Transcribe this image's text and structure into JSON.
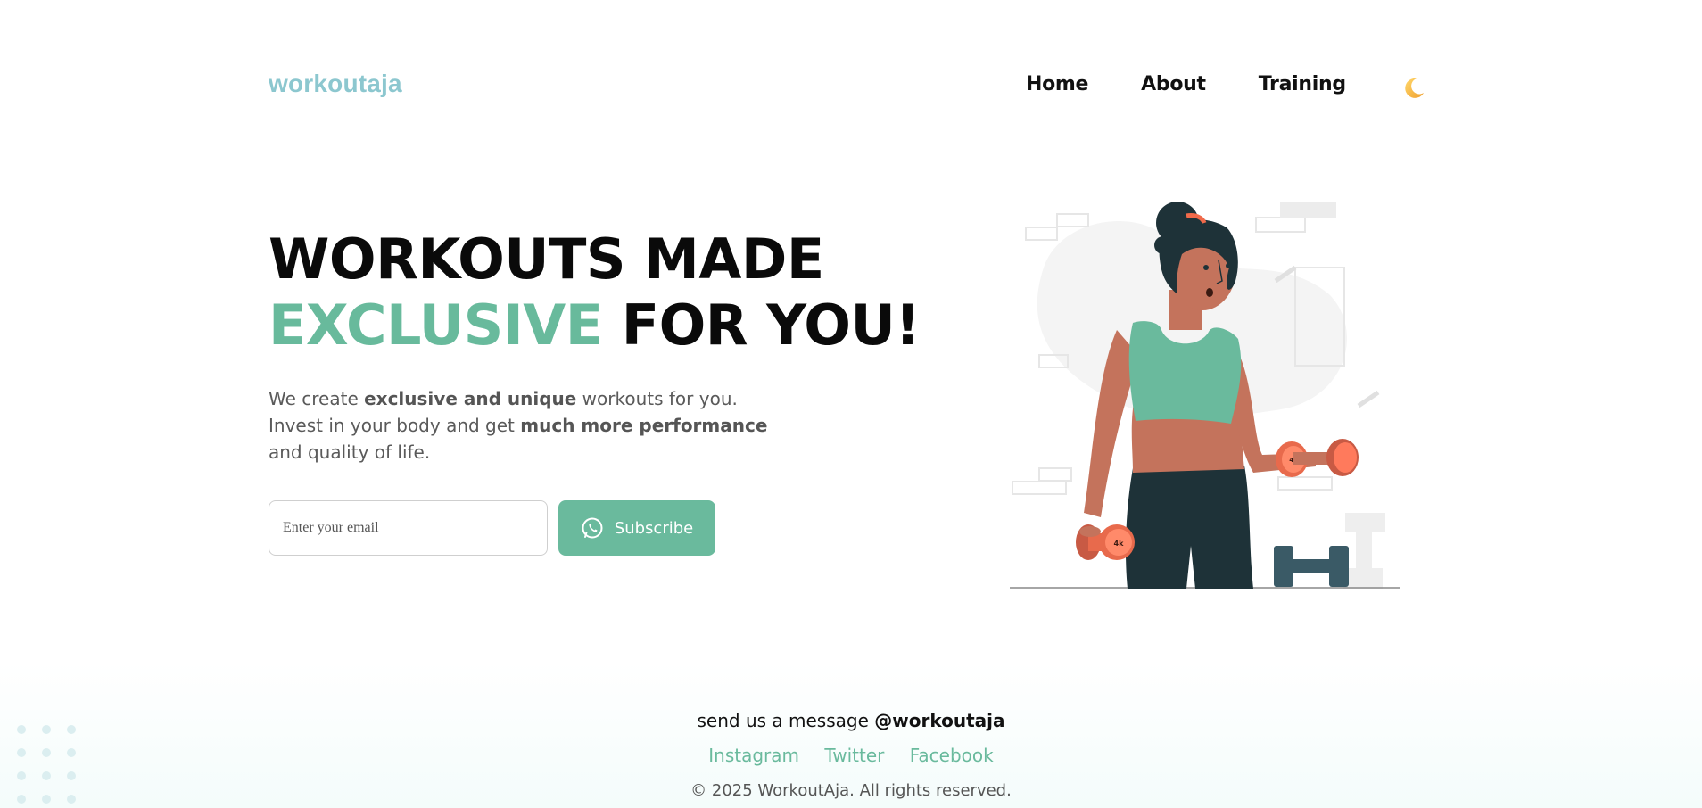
{
  "header": {
    "logo": "workoutaja",
    "nav": [
      {
        "label": "Home"
      },
      {
        "label": "About"
      },
      {
        "label": "Training"
      }
    ],
    "theme_toggle_icon": "moon-icon"
  },
  "hero": {
    "title_line1": "WORKOUTS MADE",
    "title_accent": "EXCLUSIVE",
    "title_rest": " FOR YOU!",
    "desc": {
      "p1": "We create ",
      "b1": "exclusive and unique",
      "p2": " workouts for you.",
      "p3": "Invest in your body and get ",
      "b2": "much more performance",
      "p4": "and quality of life."
    },
    "email_placeholder": "Enter your email",
    "subscribe_label": "Subscribe",
    "subscribe_icon": "whatsapp-icon"
  },
  "footer": {
    "message_prefix": "send us a message ",
    "handle": "@workoutaja",
    "links": [
      {
        "label": "Instagram"
      },
      {
        "label": "Twitter"
      },
      {
        "label": "Facebook"
      }
    ],
    "copyright": "© 2025 WorkoutAja. All rights reserved."
  },
  "colors": {
    "accent": "#6aba9d",
    "logo": "#8cc7cf",
    "text": "#111111"
  }
}
